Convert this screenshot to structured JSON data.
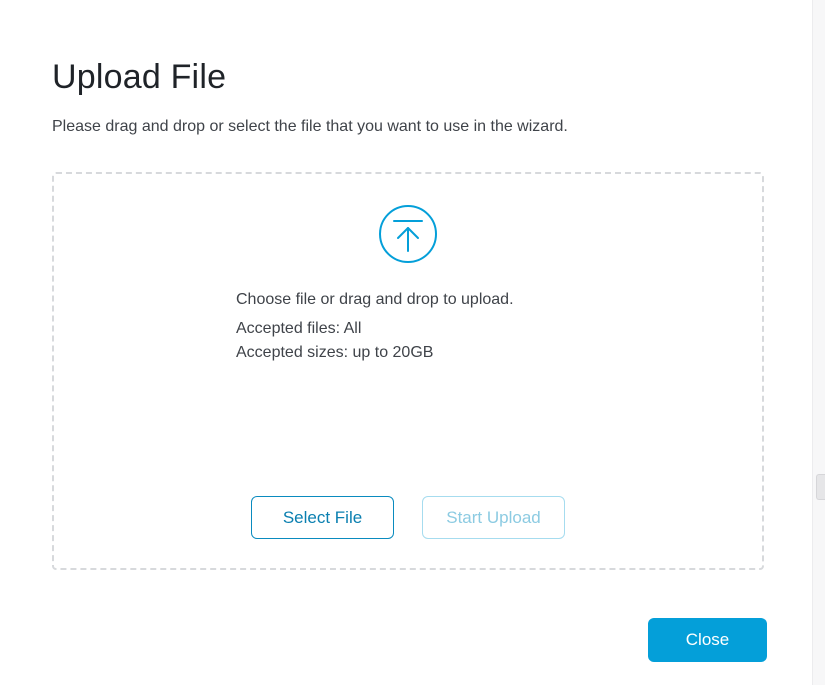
{
  "dialog": {
    "title": "Upload File",
    "subtitle": "Please drag and drop or select the file that you want to use in the wizard."
  },
  "dropzone": {
    "icon": "upload-arrow-icon",
    "instruction": "Choose file or drag and drop to upload.",
    "accepted_files": "Accepted files: All",
    "accepted_sizes": "Accepted sizes: up to 20GB",
    "select_label": "Select File",
    "start_label": "Start Upload",
    "start_enabled": false
  },
  "footer": {
    "close_label": "Close"
  },
  "colors": {
    "accent": "#049fd9",
    "accent_outline": "#0a8bbf",
    "disabled_outline": "#a6dcef",
    "dashed_border": "#d7d9dc",
    "text": "#3f4349"
  }
}
